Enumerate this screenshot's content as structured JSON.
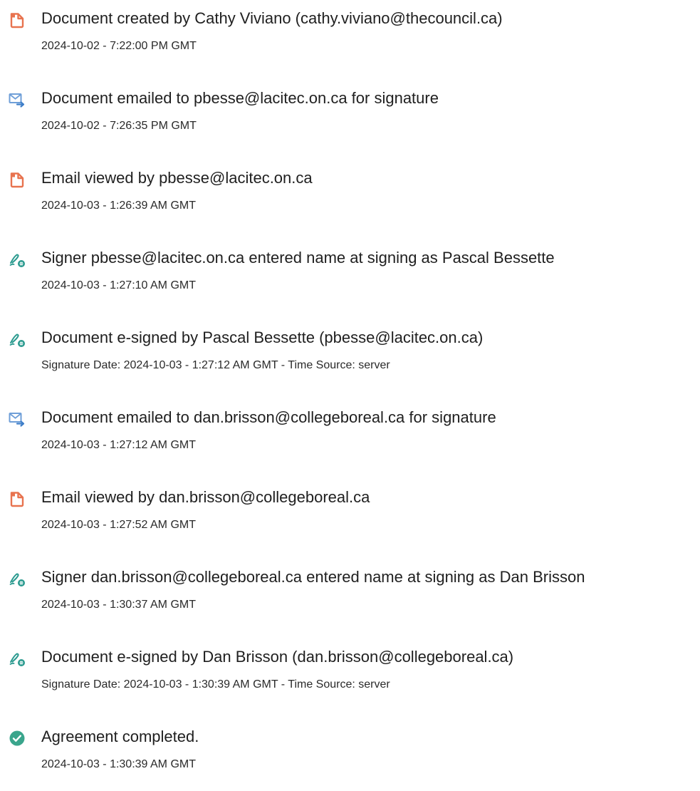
{
  "colors": {
    "document_icon": "#e8734f",
    "email_icon": "#6f9fd8",
    "sign_icon": "#2b9a8f",
    "complete_icon": "#3aa58c"
  },
  "events": [
    {
      "icon": "document-icon",
      "title": "Document created by Cathy Viviano (cathy.viviano@thecouncil.ca)",
      "detail": "2024-10-02 - 7:22:00 PM GMT"
    },
    {
      "icon": "email-sent-icon",
      "title": "Document emailed to pbesse@lacitec.on.ca for signature",
      "detail": "2024-10-02 - 7:26:35 PM GMT"
    },
    {
      "icon": "document-icon",
      "title": "Email viewed by pbesse@lacitec.on.ca",
      "detail": "2024-10-03 - 1:26:39 AM GMT"
    },
    {
      "icon": "esign-pen-icon",
      "title": "Signer pbesse@lacitec.on.ca entered name at signing as Pascal Bessette",
      "detail": "2024-10-03 - 1:27:10 AM GMT"
    },
    {
      "icon": "esign-pen-icon",
      "title": "Document e-signed by Pascal Bessette (pbesse@lacitec.on.ca)",
      "detail": "Signature Date: 2024-10-03 - 1:27:12 AM GMT - Time Source: server"
    },
    {
      "icon": "email-sent-icon",
      "title": "Document emailed to dan.brisson@collegeboreal.ca for signature",
      "detail": "2024-10-03 - 1:27:12 AM GMT"
    },
    {
      "icon": "document-icon",
      "title": "Email viewed by dan.brisson@collegeboreal.ca",
      "detail": "2024-10-03 - 1:27:52 AM GMT"
    },
    {
      "icon": "esign-pen-icon",
      "title": "Signer dan.brisson@collegeboreal.ca entered name at signing as Dan Brisson",
      "detail": "2024-10-03 - 1:30:37 AM GMT"
    },
    {
      "icon": "esign-pen-icon",
      "title": "Document e-signed by Dan Brisson (dan.brisson@collegeboreal.ca)",
      "detail": "Signature Date: 2024-10-03 - 1:30:39 AM GMT - Time Source: server"
    },
    {
      "icon": "check-circle-icon",
      "title": "Agreement completed.",
      "detail": "2024-10-03 - 1:30:39 AM GMT"
    }
  ]
}
